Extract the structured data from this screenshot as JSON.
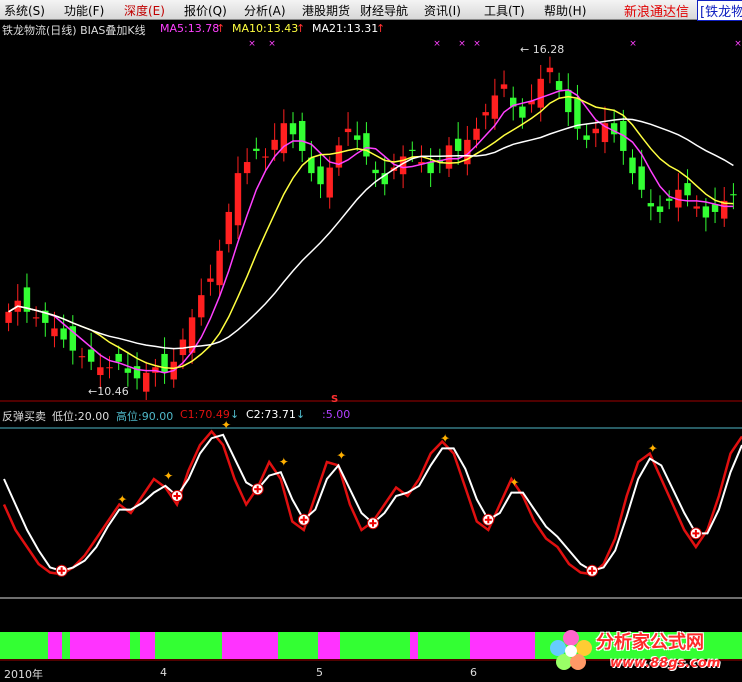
{
  "menu": {
    "items": [
      {
        "label": "系统(S)"
      },
      {
        "label": "功能(F)"
      },
      {
        "label": "深度(E)"
      },
      {
        "label": "报价(Q)"
      },
      {
        "label": "分析(A)"
      },
      {
        "label": "港股期货"
      },
      {
        "label": "财经导航"
      },
      {
        "label": "资讯(I)"
      },
      {
        "label": "工具(T)"
      },
      {
        "label": "帮助(H)"
      }
    ],
    "active_index": 2,
    "brand": "新浪通达信",
    "brand_partial": "[铁龙物"
  },
  "main_chart": {
    "title": "铁龙物流(日线) BIAS叠加K线",
    "ma5": "MA5:13.78",
    "ma10": "MA10:13.43",
    "ma21": "MA21:13.31",
    "arrow": "↑",
    "high_label": "← 16.28",
    "low_label": "←10.46",
    "signal_mark": "S"
  },
  "indicator": {
    "name": "反弹买卖",
    "low": "低位:20.00",
    "high": "高位:90.00",
    "c1": "C1:70.49",
    "c1_arrow": "↓",
    "c2": "C2:73.71",
    "c2_arrow": "↓",
    "extra": ":5.00"
  },
  "dates": {
    "year": "2010年",
    "m4": "4",
    "m5": "5",
    "m6": "6"
  },
  "logo": {
    "title": "分析家公式网",
    "url": "www.88gs.com"
  },
  "colors": {
    "up": "#ff2020",
    "down": "#33ff33",
    "ma5": "#ff40ff",
    "ma10": "#ffff40",
    "ma21": "#ffffff",
    "c1": "#e01010",
    "c2": "#ffffff",
    "grid": "#a00000",
    "magenta_band": "#ff33ff",
    "green_band": "#33ff33"
  },
  "chart_data": {
    "type": "line",
    "price_range": [
      10.2,
      16.6
    ],
    "close_series": [
      11.7,
      11.9,
      11.7,
      11.6,
      11.5,
      11.4,
      11.2,
      11.0,
      10.9,
      10.8,
      10.7,
      10.7,
      10.8,
      10.6,
      10.5,
      10.6,
      10.7,
      10.6,
      10.8,
      11.2,
      11.6,
      12.0,
      12.3,
      12.8,
      13.5,
      14.2,
      14.4,
      14.6,
      14.5,
      14.8,
      15.1,
      14.9,
      14.6,
      14.2,
      14.0,
      14.3,
      14.7,
      15.0,
      14.8,
      14.5,
      14.2,
      14.0,
      14.3,
      14.5,
      14.6,
      14.4,
      14.2,
      14.4,
      14.7,
      14.6,
      14.8,
      15.0,
      15.3,
      15.6,
      15.8,
      15.4,
      15.2,
      15.5,
      15.9,
      16.1,
      15.7,
      15.3,
      15.0,
      14.8,
      15.0,
      15.1,
      14.9,
      14.6,
      14.2,
      13.9,
      13.6,
      13.5,
      13.7,
      13.9,
      13.8,
      13.6,
      13.4,
      13.5,
      13.7,
      13.8
    ],
    "signal": {
      "low": 20,
      "high": 90,
      "c1": [
        55,
        40,
        30,
        20,
        15,
        14,
        18,
        25,
        35,
        45,
        55,
        50,
        60,
        70,
        65,
        55,
        75,
        90,
        98,
        90,
        70,
        55,
        65,
        80,
        70,
        45,
        40,
        60,
        80,
        78,
        55,
        40,
        45,
        55,
        65,
        60,
        70,
        85,
        92,
        85,
        65,
        45,
        40,
        55,
        70,
        60,
        45,
        35,
        30,
        20,
        15,
        14,
        20,
        35,
        60,
        80,
        85,
        70,
        55,
        40,
        30,
        40,
        60,
        85,
        95
      ],
      "c2": [
        70,
        55,
        40,
        28,
        18,
        16,
        18,
        22,
        30,
        42,
        52,
        52,
        56,
        62,
        66,
        60,
        70,
        85,
        94,
        96,
        82,
        68,
        64,
        72,
        74,
        58,
        46,
        52,
        70,
        78,
        64,
        50,
        44,
        50,
        60,
        62,
        66,
        78,
        88,
        88,
        76,
        58,
        46,
        50,
        62,
        62,
        52,
        42,
        36,
        28,
        20,
        16,
        18,
        28,
        48,
        70,
        82,
        78,
        64,
        50,
        38,
        38,
        52,
        74,
        90
      ]
    },
    "ylim_indicator": [
      0,
      100
    ]
  }
}
